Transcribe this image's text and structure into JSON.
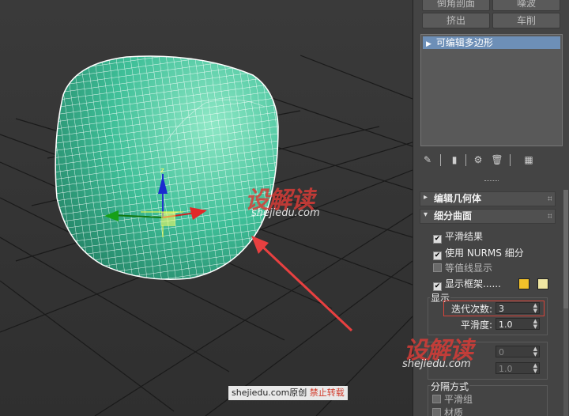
{
  "watermark": {
    "brand": "设解读",
    "domain": "shejiedu.com",
    "credit_site": "shejiedu.com原创",
    "credit_notice": "禁止转载"
  },
  "panel": {
    "top_buttons": {
      "bevel_profile": "倒角剖面",
      "lathe": "噪波",
      "extrude": "挤出",
      "lathe2": "车削"
    },
    "modifier_stack": [
      "可编辑多边形"
    ],
    "rollouts": {
      "edit_geometry": "编辑几何体",
      "subdivision": "细分曲面"
    },
    "subdivision": {
      "smooth_result": "平滑结果",
      "use_nurms": "使用 NURMS 细分",
      "isoline_display": "等值线显示",
      "show_cage": "显示框架......",
      "display_group": "显示",
      "iterations_label": "迭代次数:",
      "iterations_value": "3",
      "smoothness_label": "平滑度:",
      "smoothness_value": "1.0",
      "render_iter_value": "0",
      "render_smooth_value": "1.0",
      "separate_group": "分隔方式",
      "smoothing_groups": "平滑组",
      "materials": "材质"
    },
    "cage_colors": {
      "primary": "#f2c22a",
      "secondary": "#efe6a2"
    },
    "highlight_color": "#d9443a"
  }
}
